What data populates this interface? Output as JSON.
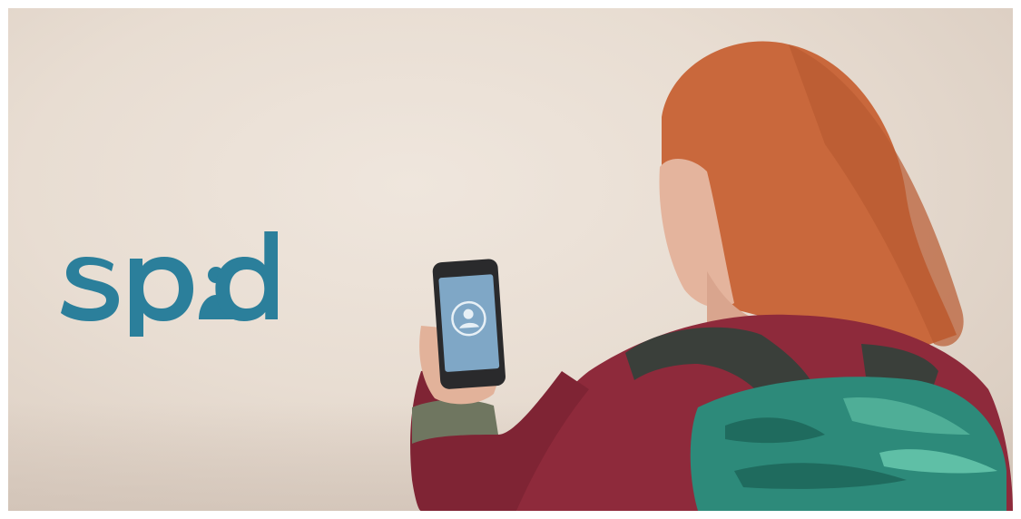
{
  "logo": {
    "text": "spd",
    "color": "#2b7f9b",
    "icon": "person-dot-icon"
  },
  "scene": {
    "subject": "woman-with-phone",
    "phone_screen_icon": "user-avatar-icon",
    "colors": {
      "sky": "#e9dfd5",
      "hair": "#c9683c",
      "sweater": "#8e2a3b",
      "backpack": "#2d8a7a",
      "strap": "#3a3f3a",
      "phone_screen": "#7fa7c6"
    }
  }
}
